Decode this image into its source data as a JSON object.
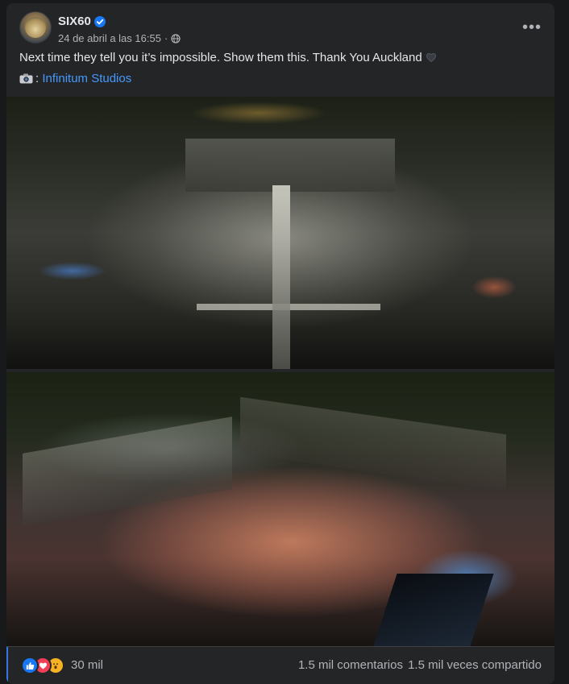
{
  "post": {
    "author": "SIX60",
    "timestamp": "24 de abril a las 16:55",
    "separator": "·",
    "text": "Next time they tell you it’s impossible. Show them this. Thank You Auckland",
    "credit_prefix": ":",
    "credit_name": "Infinitum Studios"
  },
  "icons": {
    "verified": "verified-badge-icon",
    "audience": "globe-icon",
    "more": "more-options-icon",
    "text_emoji": "black-heart-icon",
    "credit_emoji": "camera-icon"
  },
  "menu": {
    "more_label": "•••"
  },
  "footer": {
    "reactions": [
      "like",
      "love",
      "wow"
    ],
    "reaction_count": "30 mil",
    "comments": "1.5 mil comentarios",
    "shares": "1.5 mil veces compartido"
  },
  "colors": {
    "background": "#18191a",
    "card": "#242526",
    "text": "#e4e6eb",
    "secondary": "#b0b3b8",
    "link": "#4599ff",
    "verified": "#1877f2"
  }
}
